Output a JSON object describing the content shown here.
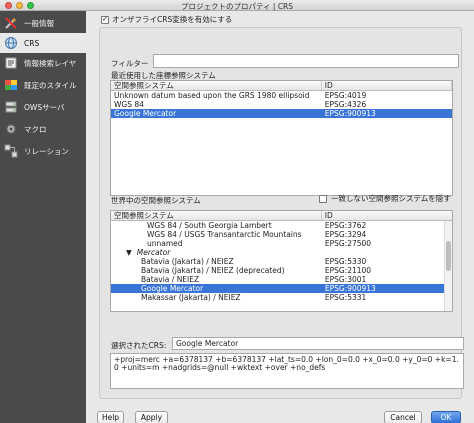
{
  "window": {
    "title": "プロジェクトのプロパティ | CRS"
  },
  "sidebar": {
    "items": [
      {
        "label": "一般情報",
        "icon": "tools-icon"
      },
      {
        "label": "CRS",
        "icon": "globe-icon"
      },
      {
        "label": "情報検索レイヤ",
        "icon": "identify-icon"
      },
      {
        "label": "既定のスタイル",
        "icon": "style-icon"
      },
      {
        "label": "OWSサーバ",
        "icon": "ows-server-icon"
      },
      {
        "label": "マクロ",
        "icon": "gear-icon"
      },
      {
        "label": "リレーション",
        "icon": "relation-icon"
      }
    ]
  },
  "crs": {
    "enable_label": "オンザフライCRS変換を有効にする",
    "enable_checked": "✓",
    "filter_label": "フィルター",
    "filter_value": "",
    "recent_label": "最近使用した座標参照システム",
    "recent_headers": [
      "空間参照システム",
      "ID"
    ],
    "recent_rows": [
      {
        "name": "Unknown datum based upon the GRS 1980 ellipsoid",
        "id": "EPSG:4019"
      },
      {
        "name": "WGS 84",
        "id": "EPSG:4326"
      },
      {
        "name": "Google Mercator",
        "id": "EPSG:900913",
        "selected": true
      }
    ],
    "world_label": "世界中の空間参照システム",
    "hide_deprecated_label": "一致しない空間参照システムを隠す",
    "world_headers": [
      "空間参照システム",
      "ID"
    ],
    "world_rows": [
      {
        "name": "WGS 84 / South Georgia Lambert",
        "id": "EPSG:3762"
      },
      {
        "name": "WGS 84 / USGS Transantarctic Mountains",
        "id": "EPSG:3294"
      },
      {
        "name": "unnamed",
        "id": "EPSG:27500"
      },
      {
        "name": "Mercator",
        "id": ""
      },
      {
        "name": "Batavia (Jakarta) / NEIEZ",
        "id": "EPSG:5330"
      },
      {
        "name": "Batavia (Jakarta) / NEIEZ (deprecated)",
        "id": "EPSG:21100"
      },
      {
        "name": "Batavia / NEIEZ",
        "id": "EPSG:3001"
      },
      {
        "name": "Google Mercator",
        "id": "EPSG:900913"
      },
      {
        "name": "Makassar (Jakarta) / NEIEZ",
        "id": "EPSG:5331"
      }
    ],
    "selected_crs_label": "選択されたCRS:",
    "selected_crs_value": "Google Mercator",
    "proj_string": "+proj=merc +a=6378137 +b=6378137 +lat_ts=0.0 +lon_0=0.0 +x_0=0.0 +y_0=0 +k=1.0 +units=m +nadgrids=@null +wktext +over +no_defs"
  },
  "buttons": {
    "help": "Help",
    "apply": "Apply",
    "cancel": "Cancel",
    "ok": "OK"
  },
  "colors": {
    "selection": "#3875d7",
    "sidebar": "#4a4a4a",
    "primary_button": "#2c6fd6"
  }
}
